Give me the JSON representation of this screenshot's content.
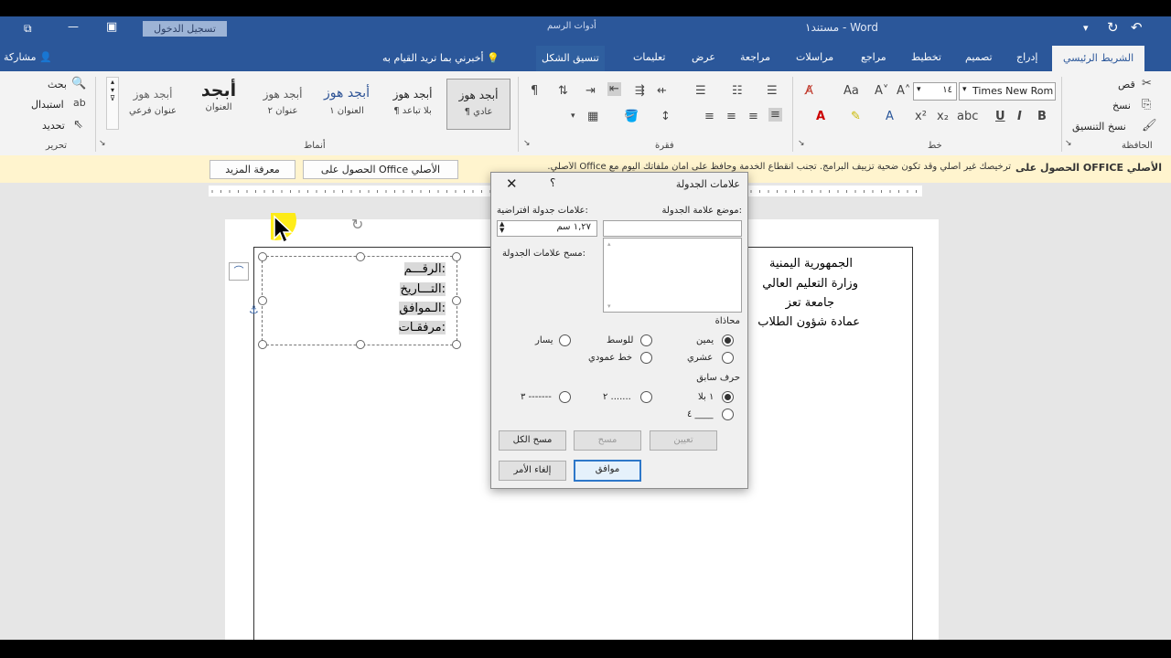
{
  "window": {
    "title": "مستند١ - Word",
    "drawing_tools": "أدوات الرسم",
    "sign_in": "تسجيل الدخول"
  },
  "tabs": {
    "home": "الشريط الرئيسي",
    "insert": "إدراج",
    "design": "تصميم",
    "layout": "تخطيط",
    "references": "مراجع",
    "mailings": "مراسلات",
    "review": "مراجعة",
    "view": "عرض",
    "help": "تعليمات",
    "format": "تنسيق الشكل",
    "tell_me": "أخبرني بما تريد القيام به",
    "share": "مشاركة"
  },
  "ribbon": {
    "clipboard": {
      "cut": "قص",
      "copy": "نسخ",
      "format_painter": "نسخ التنسيق",
      "group": "الحافظة"
    },
    "font": {
      "name": "Times New Rom",
      "size": "١٤",
      "group": "خط"
    },
    "paragraph": {
      "group": "فقرة"
    },
    "styles": {
      "group": "أنماط",
      "items": [
        {
          "sample": "أبجد هوز",
          "name": "¶ عادي"
        },
        {
          "sample": "أبجد هوز",
          "name": "¶ بلا تباعد"
        },
        {
          "sample": "أبجد هوز",
          "name": "العنوان ١"
        },
        {
          "sample": "أبجد هوز",
          "name": "عنوان ٢"
        },
        {
          "sample": "أبجد",
          "name": "العنوان"
        },
        {
          "sample": "أبجد هوز",
          "name": "عنوان فرعي"
        }
      ]
    },
    "editing": {
      "find": "بحث",
      "replace": "استبدال",
      "select": "تحديد",
      "group": "تحرير"
    }
  },
  "message_bar": {
    "title": "الحصول على OFFICE الأصلي",
    "text": "ترخيصك غير أصلي وقد تكون ضحية تزييف البرامج. تجنب انقطاع الخدمة وحافظ على أمان ملفاتك اليوم مع Office الأصلي.",
    "get_genuine": "الحصول على Office الأصلي",
    "learn_more": "معرفة المزيد"
  },
  "document": {
    "header_lines": [
      "الجمهورية اليمنية",
      "وزارة التعليم العالي",
      "جامعة تعز",
      "عمادة شؤون الطلاب"
    ],
    "textbox_lines": [
      "الرقـــم:",
      "التـــاريخ:",
      "الـموافق:",
      "مرفقـات:"
    ]
  },
  "dialog": {
    "title": "علامات الجدولة",
    "help": "؟",
    "tab_stop_position_label": "موضع علامة الجدولة:",
    "tab_stop_position_value": "",
    "default_tab_stops_label": "علامات جدولة افتراضية:",
    "default_tab_stops_value": "١,٢٧ سم",
    "tab_stops_to_clear_label": "مسح علامات الجدولة:",
    "alignment_label": "محاذاة",
    "alignment_options": [
      "يمين",
      "للوسط",
      "يسار",
      "عشري",
      "خط عمودي"
    ],
    "alignment_selected": "يمين",
    "leader_label": "حرف سابق",
    "leader_options": [
      "١ بلا",
      "٢ .......",
      "٣ -------",
      "٤ ____"
    ],
    "leader_selected": "١ بلا",
    "buttons": {
      "set": "تعيين",
      "clear": "مسح",
      "clear_all": "مسح الكل",
      "ok": "موافق",
      "cancel": "إلغاء الأمر"
    }
  },
  "colors": {
    "ribbon_blue": "#2b579a",
    "message_bar": "#fff4ce",
    "ok_border": "#2d77c9"
  }
}
